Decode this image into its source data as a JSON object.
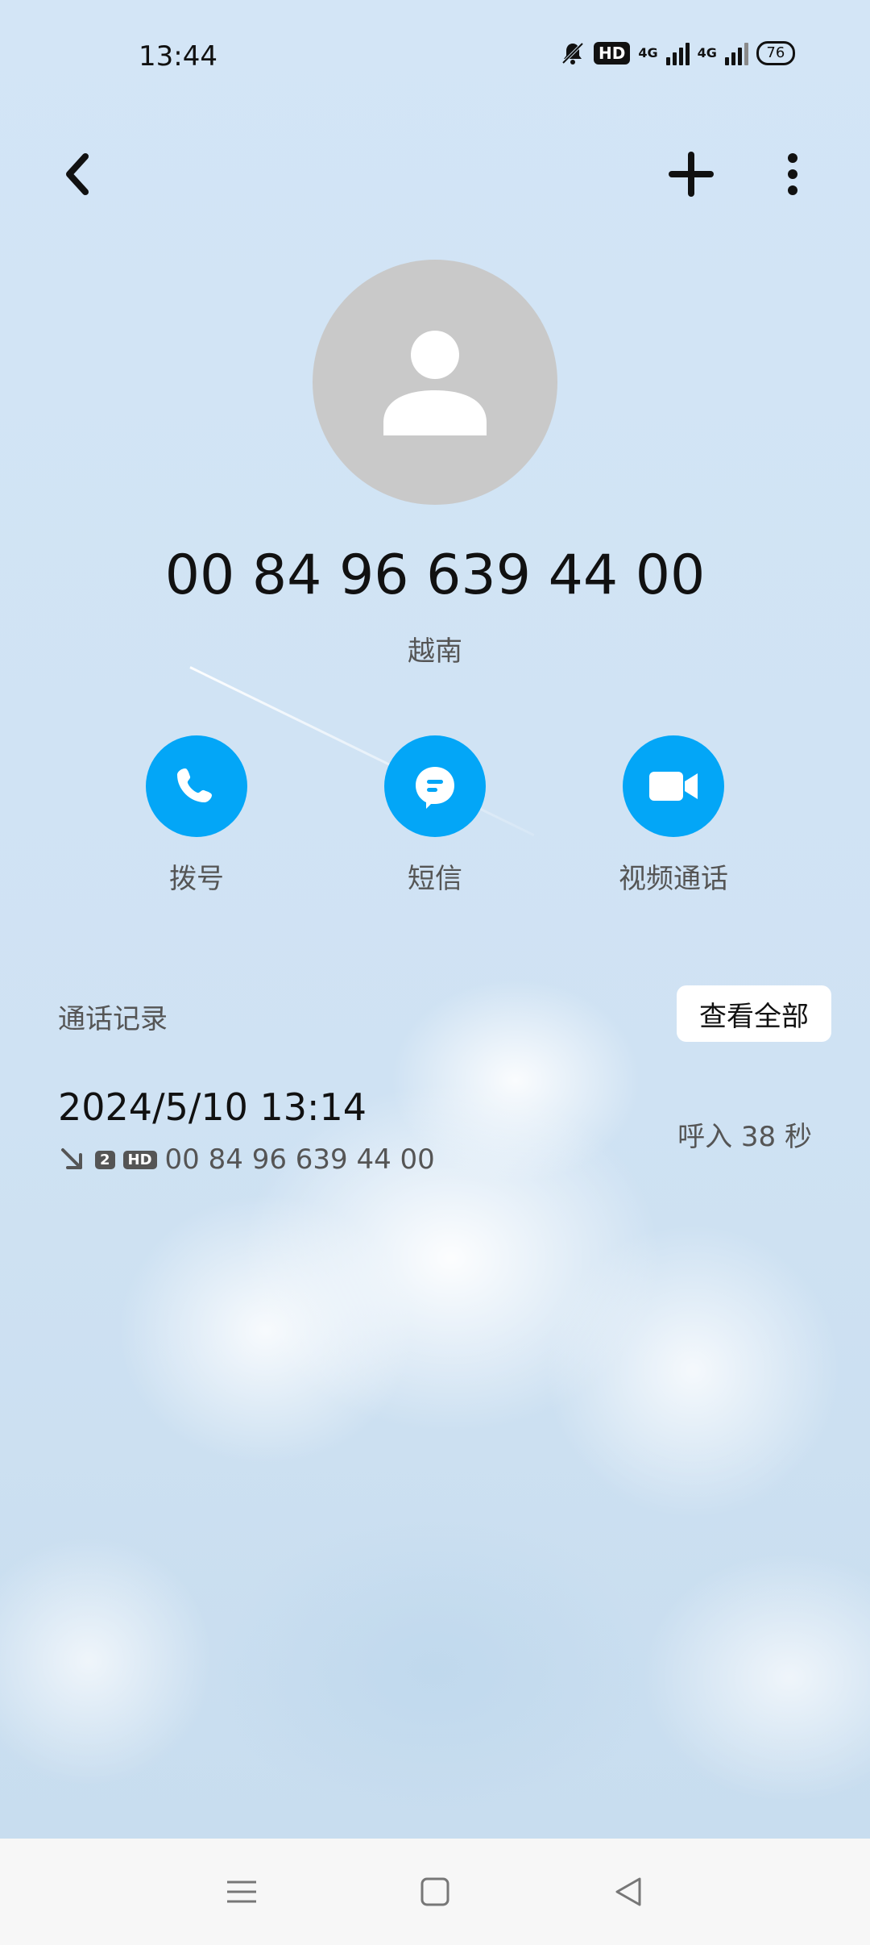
{
  "status_bar": {
    "time": "13:44",
    "hd": "HD",
    "net1": "4G",
    "net2": "4G",
    "battery": "76"
  },
  "contact": {
    "number": "00 84 96 639 44 00",
    "region": "越南"
  },
  "actions": {
    "dial": "拨号",
    "sms": "短信",
    "video": "视频通话"
  },
  "call_log": {
    "title": "通话记录",
    "view_all": "查看全部",
    "entries": [
      {
        "datetime": "2024/5/10 13:14",
        "sim": "2",
        "hd": "HD",
        "number": "00 84 96 639 44 00",
        "direction": "呼入",
        "duration": "38 秒"
      }
    ]
  },
  "colors": {
    "accent": "#03a6f7",
    "background": "#d3e5f5"
  }
}
